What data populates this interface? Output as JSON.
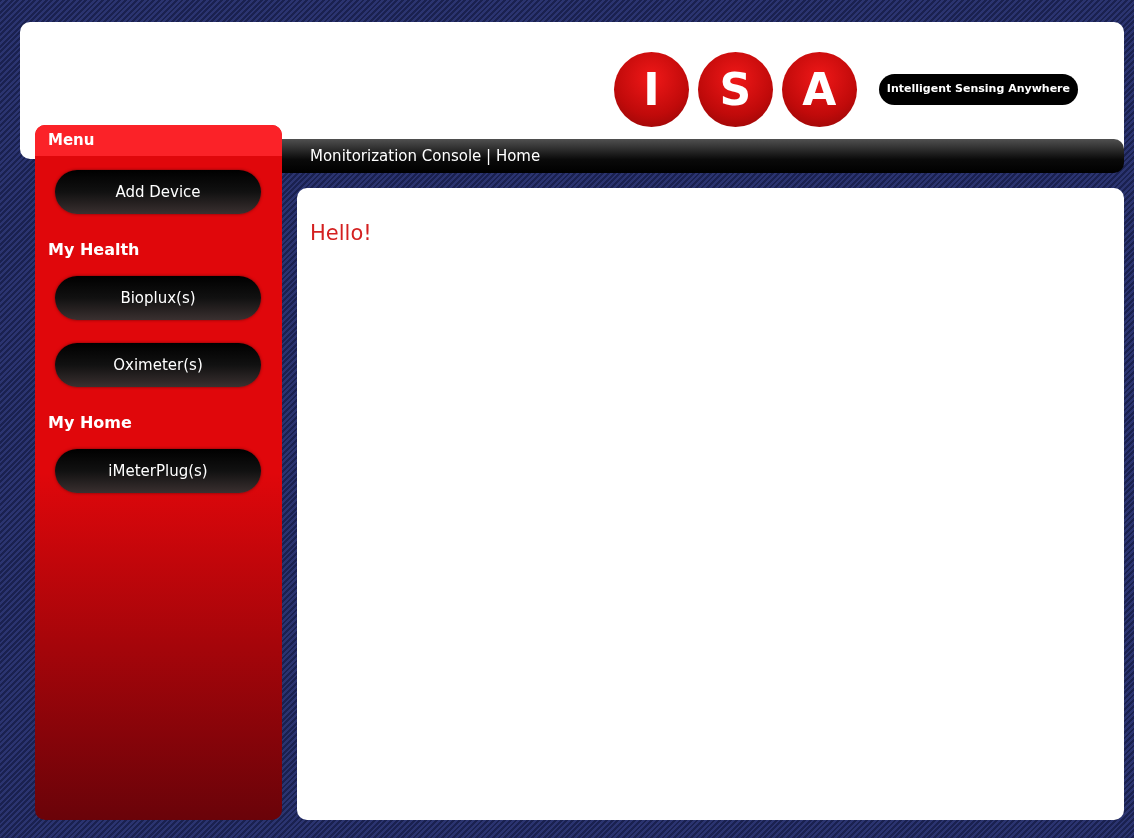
{
  "logo": {
    "letters": [
      "I",
      "S",
      "A"
    ],
    "tagline": "Intelligent Sensing Anywhere"
  },
  "menu": {
    "title": "Menu",
    "groups": [
      {
        "buttons": [
          "Add Device"
        ]
      },
      {
        "heading": "My Health",
        "buttons": [
          "Bioplux(s)",
          "Oximeter(s)"
        ]
      },
      {
        "heading": "My Home",
        "buttons": [
          "iMeterPlug(s)"
        ]
      }
    ]
  },
  "breadcrumb": "Monitorization Console | Home",
  "content": {
    "greeting": "Hello!"
  }
}
